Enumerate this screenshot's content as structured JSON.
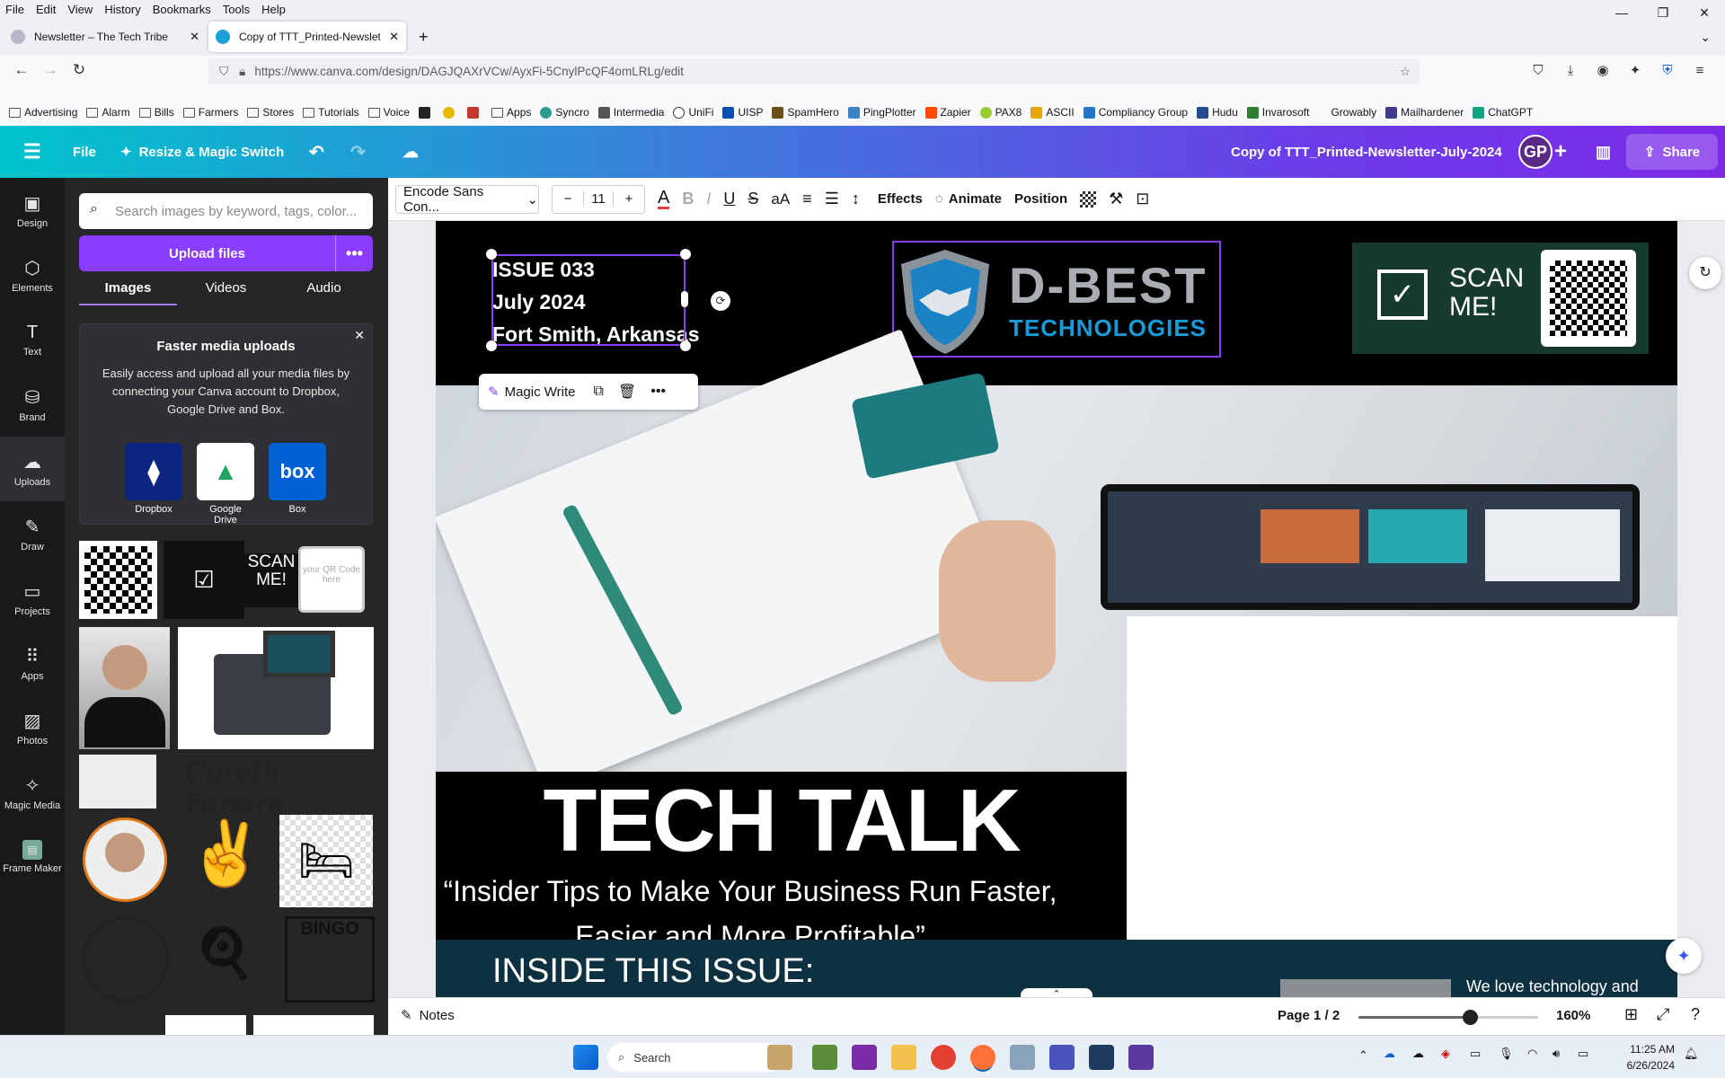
{
  "menu": [
    "File",
    "Edit",
    "View",
    "History",
    "Bookmarks",
    "Tools",
    "Help"
  ],
  "tabs": [
    {
      "label": "Newsletter – The Tech Tribe",
      "close": "✕"
    },
    {
      "label": "Copy of TTT_Printed-Newslette",
      "close": "✕"
    }
  ],
  "new_tab": "+",
  "url": "https://www.canva.com/design/DAGJQAXrVCw/AyxFi-5CnylPcQF4omLRLg/edit",
  "bookmarks": [
    "Advertising",
    "Alarm",
    "Bills",
    "Farmers",
    "Stores",
    "Tutorials",
    "Voice",
    "Apps",
    "Syncro",
    "Intermedia",
    "UniFi",
    "UISP",
    "SpamHero",
    "PingPlotter",
    "Zapier",
    "PAX8",
    "ASCII",
    "Compliancy Group",
    "Hudu",
    "Invarosoft",
    "Growably",
    "Mailhardener",
    "ChatGPT"
  ],
  "canva_header": {
    "file": "File",
    "resize": "Resize & Magic Switch",
    "doc_title": "Copy of  TTT_Printed-Newsletter-July-2024",
    "avatar": "GP",
    "share": "Share"
  },
  "rail": [
    "Design",
    "Elements",
    "Text",
    "Brand",
    "Uploads",
    "Draw",
    "Projects",
    "Apps",
    "Photos",
    "Magic Media",
    "Frame Maker"
  ],
  "panel": {
    "search_placeholder": "Search images by keyword, tags, color...",
    "upload": "Upload files",
    "tabs": [
      "Images",
      "Videos",
      "Audio"
    ],
    "promo_title": "Faster media uploads",
    "promo_text": "Easily access and upload all your media files by connecting your Canva account to Dropbox, Google Drive and Box.",
    "services": [
      "Dropbox",
      "Google Drive",
      "Box"
    ],
    "scan_text": "SCAN ME!",
    "qr_placeholder": "your QR Code here",
    "signature": "Gareth Pereira",
    "bingo": "BINGO"
  },
  "toolbar": {
    "font": "Encode Sans Con...",
    "size": "11",
    "effects": "Effects",
    "animate": "Animate",
    "position": "Position"
  },
  "page": {
    "issue_lines": [
      "ISSUE 033",
      "July 2024",
      "Fort Smith, Arkansas"
    ],
    "logo_top": "D-BEST",
    "logo_bottom": "TECHNOLOGIES",
    "scan": "SCAN ME!",
    "title": "TECH TALK",
    "subtitle": "“Insider Tips to Make Your Business Run Faster, Easier and More Profitable”",
    "inside": "INSIDE THIS ISSUE:",
    "right_text": "We love technology and",
    "magic_write": "Magic Write"
  },
  "bottom": {
    "notes": "Notes",
    "page": "Page 1 / 2",
    "zoom": "160%",
    "zoom_level": 0.62
  },
  "taskbar": {
    "search": "Search",
    "time": "11:25 AM",
    "date": "6/26/2024"
  },
  "colors": {
    "accent": "#8b3dff",
    "header_start": "#00c4cc",
    "header_end": "#7d2ae8",
    "scan_bg": "#173a2e",
    "inside_bg": "#0d3140"
  }
}
